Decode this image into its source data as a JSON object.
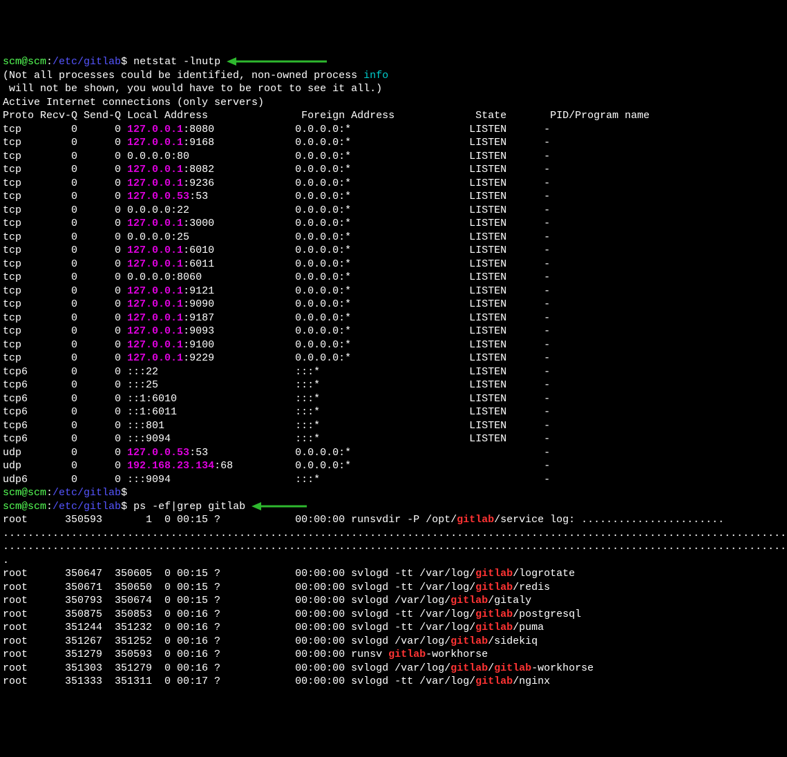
{
  "prompt": {
    "user": "scm@scm",
    "sep": ":",
    "path": "/etc/gitlab",
    "sym": "$"
  },
  "commands": {
    "cmd1": "netstat -lnutp",
    "cmd2": "ps -ef|grep gitlab",
    "empty": ""
  },
  "netstat": {
    "note1": "(Not all processes could be identified, non-owned process ",
    "note1b": "info",
    "note2": " will not be shown, you would have to be root to see it all.)",
    "active": "Active Internet connections (only servers)",
    "headers": {
      "proto": "Proto",
      "recvq": "Recv-Q",
      "sendq": "Send-Q",
      "local": "Local Address",
      "foreign": "Foreign Address",
      "state": "State",
      "pid": "PID/Program name"
    },
    "rows": [
      {
        "proto": "tcp",
        "recv": "0",
        "send": "0",
        "ip": "127.0.0.1",
        "port": ":8080",
        "foreign": "0.0.0.0:*",
        "state": "LISTEN",
        "pid": "-"
      },
      {
        "proto": "tcp",
        "recv": "0",
        "send": "0",
        "ip": "127.0.0.1",
        "port": ":9168",
        "foreign": "0.0.0.0:*",
        "state": "LISTEN",
        "pid": "-"
      },
      {
        "proto": "tcp",
        "recv": "0",
        "send": "0",
        "ip": "",
        "port": "0.0.0.0:80",
        "foreign": "0.0.0.0:*",
        "state": "LISTEN",
        "pid": "-"
      },
      {
        "proto": "tcp",
        "recv": "0",
        "send": "0",
        "ip": "127.0.0.1",
        "port": ":8082",
        "foreign": "0.0.0.0:*",
        "state": "LISTEN",
        "pid": "-"
      },
      {
        "proto": "tcp",
        "recv": "0",
        "send": "0",
        "ip": "127.0.0.1",
        "port": ":9236",
        "foreign": "0.0.0.0:*",
        "state": "LISTEN",
        "pid": "-"
      },
      {
        "proto": "tcp",
        "recv": "0",
        "send": "0",
        "ip": "127.0.0.53",
        "port": ":53",
        "foreign": "0.0.0.0:*",
        "state": "LISTEN",
        "pid": "-"
      },
      {
        "proto": "tcp",
        "recv": "0",
        "send": "0",
        "ip": "",
        "port": "0.0.0.0:22",
        "foreign": "0.0.0.0:*",
        "state": "LISTEN",
        "pid": "-"
      },
      {
        "proto": "tcp",
        "recv": "0",
        "send": "0",
        "ip": "127.0.0.1",
        "port": ":3000",
        "foreign": "0.0.0.0:*",
        "state": "LISTEN",
        "pid": "-"
      },
      {
        "proto": "tcp",
        "recv": "0",
        "send": "0",
        "ip": "",
        "port": "0.0.0.0:25",
        "foreign": "0.0.0.0:*",
        "state": "LISTEN",
        "pid": "-"
      },
      {
        "proto": "tcp",
        "recv": "0",
        "send": "0",
        "ip": "127.0.0.1",
        "port": ":6010",
        "foreign": "0.0.0.0:*",
        "state": "LISTEN",
        "pid": "-"
      },
      {
        "proto": "tcp",
        "recv": "0",
        "send": "0",
        "ip": "127.0.0.1",
        "port": ":6011",
        "foreign": "0.0.0.0:*",
        "state": "LISTEN",
        "pid": "-"
      },
      {
        "proto": "tcp",
        "recv": "0",
        "send": "0",
        "ip": "",
        "port": "0.0.0.0:8060",
        "foreign": "0.0.0.0:*",
        "state": "LISTEN",
        "pid": "-"
      },
      {
        "proto": "tcp",
        "recv": "0",
        "send": "0",
        "ip": "127.0.0.1",
        "port": ":9121",
        "foreign": "0.0.0.0:*",
        "state": "LISTEN",
        "pid": "-"
      },
      {
        "proto": "tcp",
        "recv": "0",
        "send": "0",
        "ip": "127.0.0.1",
        "port": ":9090",
        "foreign": "0.0.0.0:*",
        "state": "LISTEN",
        "pid": "-"
      },
      {
        "proto": "tcp",
        "recv": "0",
        "send": "0",
        "ip": "127.0.0.1",
        "port": ":9187",
        "foreign": "0.0.0.0:*",
        "state": "LISTEN",
        "pid": "-"
      },
      {
        "proto": "tcp",
        "recv": "0",
        "send": "0",
        "ip": "127.0.0.1",
        "port": ":9093",
        "foreign": "0.0.0.0:*",
        "state": "LISTEN",
        "pid": "-"
      },
      {
        "proto": "tcp",
        "recv": "0",
        "send": "0",
        "ip": "127.0.0.1",
        "port": ":9100",
        "foreign": "0.0.0.0:*",
        "state": "LISTEN",
        "pid": "-"
      },
      {
        "proto": "tcp",
        "recv": "0",
        "send": "0",
        "ip": "127.0.0.1",
        "port": ":9229",
        "foreign": "0.0.0.0:*",
        "state": "LISTEN",
        "pid": "-"
      },
      {
        "proto": "tcp6",
        "recv": "0",
        "send": "0",
        "ip": "",
        "port": ":::22",
        "foreign": ":::*",
        "state": "LISTEN",
        "pid": "-"
      },
      {
        "proto": "tcp6",
        "recv": "0",
        "send": "0",
        "ip": "",
        "port": ":::25",
        "foreign": ":::*",
        "state": "LISTEN",
        "pid": "-"
      },
      {
        "proto": "tcp6",
        "recv": "0",
        "send": "0",
        "ip": "",
        "port": "::1:6010",
        "foreign": ":::*",
        "state": "LISTEN",
        "pid": "-"
      },
      {
        "proto": "tcp6",
        "recv": "0",
        "send": "0",
        "ip": "",
        "port": "::1:6011",
        "foreign": ":::*",
        "state": "LISTEN",
        "pid": "-"
      },
      {
        "proto": "tcp6",
        "recv": "0",
        "send": "0",
        "ip": "",
        "port": ":::801",
        "foreign": ":::*",
        "state": "LISTEN",
        "pid": "-"
      },
      {
        "proto": "tcp6",
        "recv": "0",
        "send": "0",
        "ip": "",
        "port": ":::9094",
        "foreign": ":::*",
        "state": "LISTEN",
        "pid": "-"
      },
      {
        "proto": "udp",
        "recv": "0",
        "send": "0",
        "ip": "127.0.0.53",
        "port": ":53",
        "foreign": "0.0.0.0:*",
        "state": "",
        "pid": "-"
      },
      {
        "proto": "udp",
        "recv": "0",
        "send": "0",
        "ip": "192.168.23.134",
        "port": ":68",
        "foreign": "0.0.0.0:*",
        "state": "",
        "pid": "-"
      },
      {
        "proto": "udp6",
        "recv": "0",
        "send": "0",
        "ip": "",
        "port": ":::9094",
        "foreign": ":::*",
        "state": "",
        "pid": "-"
      }
    ]
  },
  "ps": {
    "first": {
      "user": "root",
      "pid": "350593",
      "ppid": "1",
      "c": "0",
      "stime": "00:15",
      "tty": "?",
      "time": "00:00:00",
      "cmd1": "runsvdir -P /opt/",
      "hl": "gitlab",
      "cmd2": "/service log: ......................."
    },
    "rows": [
      {
        "user": "root",
        "pid": "350647",
        "ppid": "350605",
        "c": "0",
        "stime": "00:15",
        "tty": "?",
        "time": "00:00:00",
        "cmd1": "svlogd -tt /var/log/",
        "hl": "gitlab",
        "cmd2": "/logrotate"
      },
      {
        "user": "root",
        "pid": "350671",
        "ppid": "350650",
        "c": "0",
        "stime": "00:15",
        "tty": "?",
        "time": "00:00:00",
        "cmd1": "svlogd -tt /var/log/",
        "hl": "gitlab",
        "cmd2": "/redis"
      },
      {
        "user": "root",
        "pid": "350793",
        "ppid": "350674",
        "c": "0",
        "stime": "00:15",
        "tty": "?",
        "time": "00:00:00",
        "cmd1": "svlogd /var/log/",
        "hl": "gitlab",
        "cmd2": "/gitaly"
      },
      {
        "user": "root",
        "pid": "350875",
        "ppid": "350853",
        "c": "0",
        "stime": "00:16",
        "tty": "?",
        "time": "00:00:00",
        "cmd1": "svlogd -tt /var/log/",
        "hl": "gitlab",
        "cmd2": "/postgresql"
      },
      {
        "user": "root",
        "pid": "351244",
        "ppid": "351232",
        "c": "0",
        "stime": "00:16",
        "tty": "?",
        "time": "00:00:00",
        "cmd1": "svlogd -tt /var/log/",
        "hl": "gitlab",
        "cmd2": "/puma"
      },
      {
        "user": "root",
        "pid": "351267",
        "ppid": "351252",
        "c": "0",
        "stime": "00:16",
        "tty": "?",
        "time": "00:00:00",
        "cmd1": "svlogd /var/log/",
        "hl": "gitlab",
        "cmd2": "/sidekiq"
      },
      {
        "user": "root",
        "pid": "351279",
        "ppid": "350593",
        "c": "0",
        "stime": "00:16",
        "tty": "?",
        "time": "00:00:00",
        "cmd1": "runsv ",
        "hl": "gitlab",
        "cmd2": "-workhorse"
      },
      {
        "user": "root",
        "pid": "351303",
        "ppid": "351279",
        "c": "0",
        "stime": "00:16",
        "tty": "?",
        "time": "00:00:00",
        "cmd1": "svlogd /var/log/",
        "hl": "gitlab",
        "cmd2": "/",
        "hl2": "gitlab",
        "cmd3": "-workhorse"
      },
      {
        "user": "root",
        "pid": "351333",
        "ppid": "351311",
        "c": "0",
        "stime": "00:17",
        "tty": "?",
        "time": "00:00:00",
        "cmd1": "svlogd -tt /var/log/",
        "hl": "gitlab",
        "cmd2": "/nginx"
      }
    ]
  },
  "dots": "........................................................................................................................................",
  "dot": "."
}
